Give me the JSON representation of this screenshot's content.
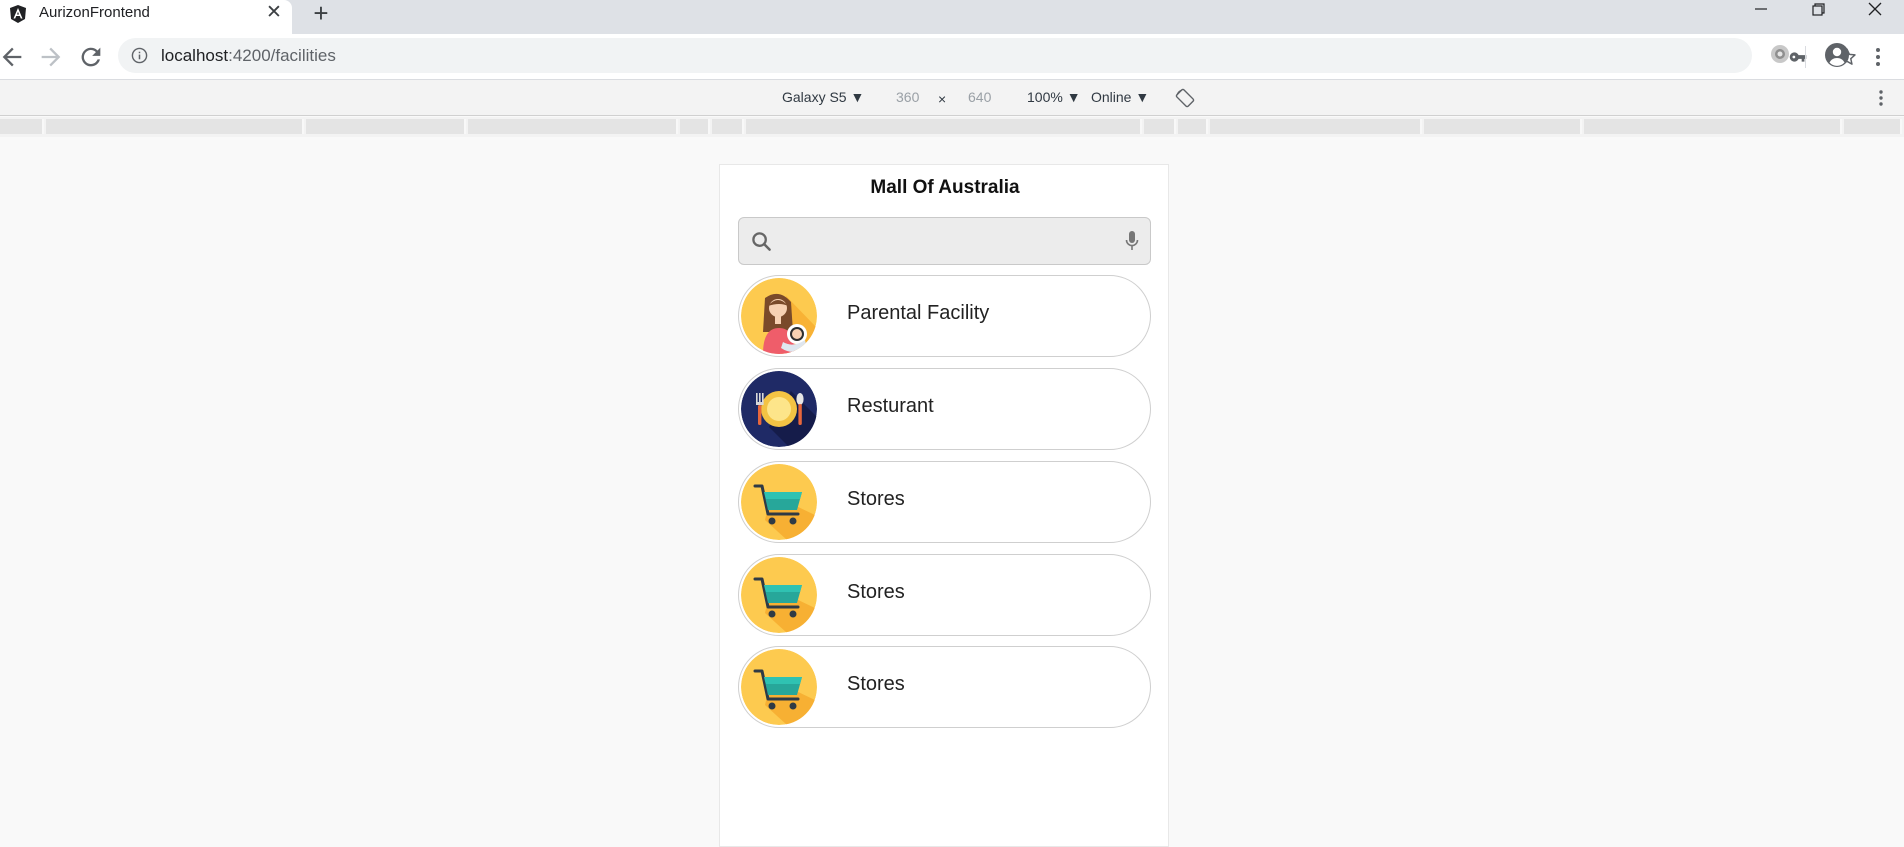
{
  "browser": {
    "tab_title": "AurizonFrontend",
    "tab_close": "✕",
    "new_tab": "+",
    "url_host": "localhost",
    "url_path": ":4200/facilities"
  },
  "device_toolbar": {
    "device": "Galaxy S5 ▼",
    "width": "360",
    "times": "×",
    "height": "640",
    "zoom": "100% ▼",
    "network": "Online ▼"
  },
  "page": {
    "title": "Mall Of Australia",
    "search": {
      "value": "",
      "placeholder": ""
    },
    "facilities": [
      {
        "label": "Parental Facility",
        "icon": "parent-baby-icon"
      },
      {
        "label": "Resturant",
        "icon": "plate-cutlery-icon"
      },
      {
        "label": "Stores",
        "icon": "shopping-cart-icon"
      },
      {
        "label": "Stores",
        "icon": "shopping-cart-icon"
      },
      {
        "label": "Stores",
        "icon": "shopping-cart-icon"
      }
    ]
  },
  "colors": {
    "icon_yellow": "#fdca4f",
    "icon_navy": "#1f2a66",
    "cart_teal": "#27a79a"
  }
}
